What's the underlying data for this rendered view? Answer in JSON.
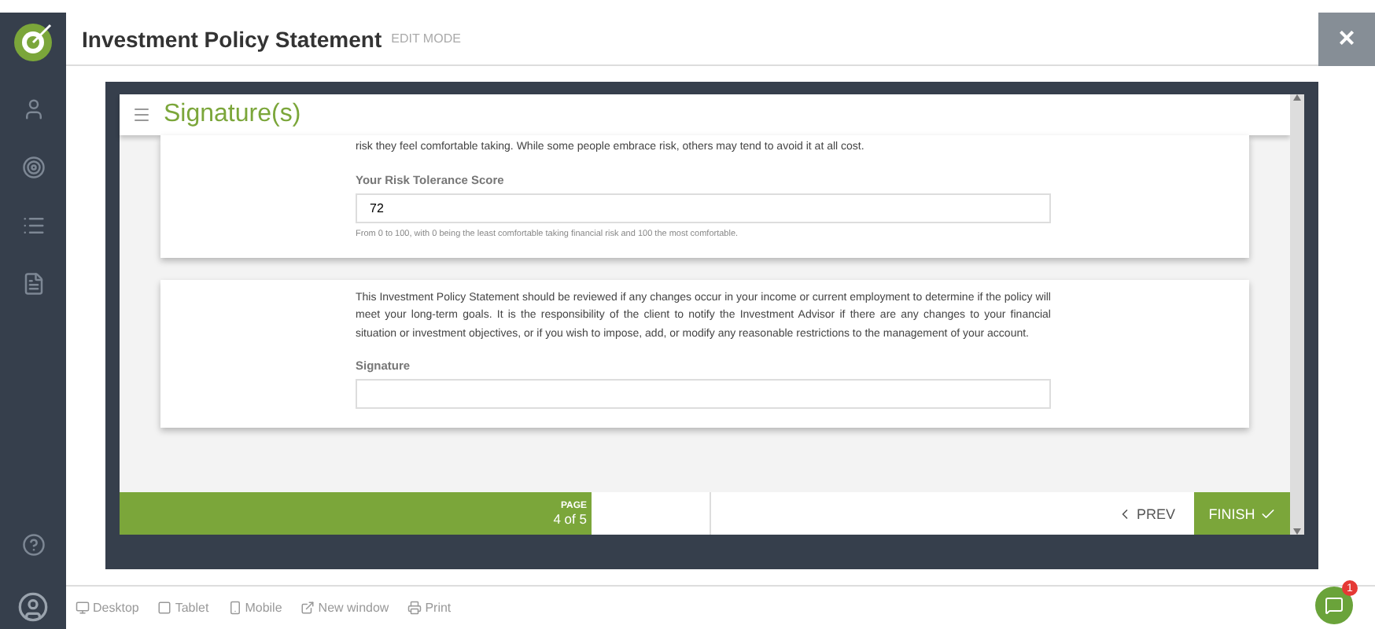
{
  "header": {
    "title": "Investment Policy Statement",
    "mode": "EDIT MODE",
    "close": "×"
  },
  "section": {
    "title": "Signature(s)"
  },
  "cards": [
    {
      "kind": "score",
      "intro": "risk they feel comfortable taking. While some people embrace risk, others may tend to avoid it at all cost.",
      "label": "Your Risk Tolerance Score",
      "value": "72",
      "help": "From 0 to 100, with 0 being the least comfortable taking financial risk and 100 the most comfortable."
    },
    {
      "kind": "signature",
      "intro": "This Investment Policy Statement should be reviewed if any changes occur in your income or current employment to determine if the policy will meet your long-term goals. It is the responsibility of the client to notify the Investment Advisor if there are any changes to your financial situation or investment objectives, or if you wish to impose, add, or modify any reasonable restrictions to the management of your account.",
      "label": "Signature"
    }
  ],
  "footer": {
    "page_label": "PAGE",
    "page": "4 of 5",
    "prev": "PREV",
    "finish": "FINISH"
  },
  "toolbar": [
    {
      "kind": "desktop",
      "label": "Desktop"
    },
    {
      "kind": "tablet",
      "label": "Tablet"
    },
    {
      "kind": "mobile",
      "label": "Mobile"
    },
    {
      "kind": "window",
      "label": "New window"
    },
    {
      "kind": "print",
      "label": "Print"
    }
  ],
  "chat": {
    "badge": "1"
  }
}
